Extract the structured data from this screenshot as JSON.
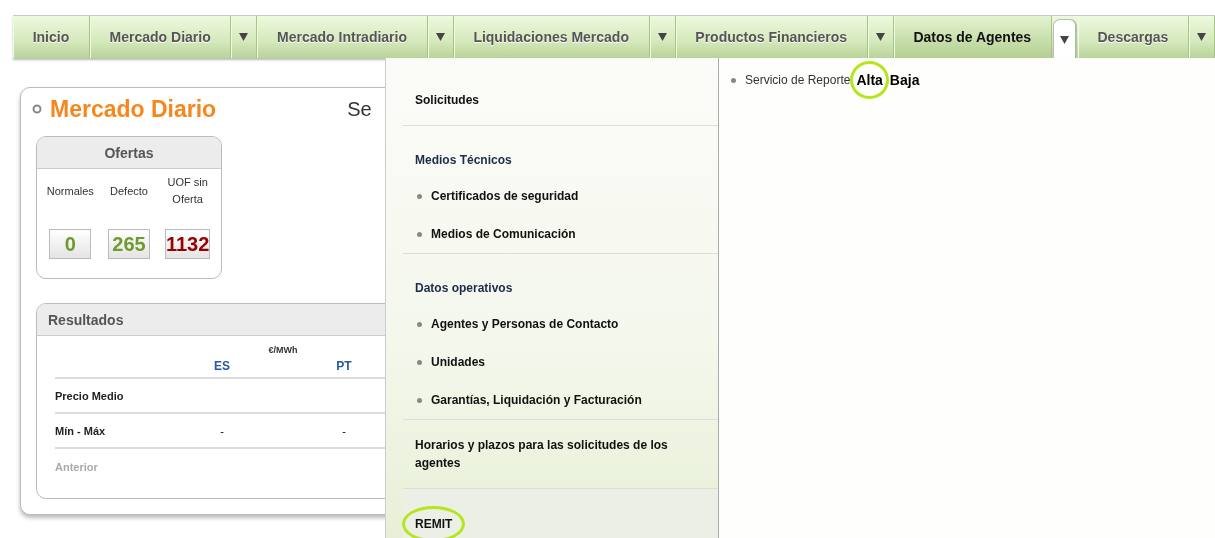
{
  "nav": {
    "items": [
      {
        "label": "Inicio",
        "has_menu": false,
        "selected": false
      },
      {
        "label": "Mercado Diario",
        "has_menu": true,
        "selected": false
      },
      {
        "label": "Mercado Intradiario",
        "has_menu": true,
        "selected": false
      },
      {
        "label": "Liquidaciones Mercado",
        "has_menu": true,
        "selected": false
      },
      {
        "label": "Productos Financieros",
        "has_menu": true,
        "selected": false
      },
      {
        "label": "Datos de Agentes",
        "has_menu": true,
        "selected": true
      },
      {
        "label": "Descargas",
        "has_menu": true,
        "selected": false
      }
    ]
  },
  "card": {
    "title": "Mercado Diario",
    "title_right": "Se",
    "offers": {
      "title": "Ofertas",
      "columns": [
        {
          "label": "Normales",
          "value": "0",
          "color": "#6f9a2e"
        },
        {
          "label": "Defecto",
          "value": "265",
          "color": "#6f9a2e"
        },
        {
          "label": "UOF sin Oferta",
          "value": "1132",
          "color": "#990000"
        }
      ]
    },
    "results": {
      "title": "Resultados",
      "unit": "€/MWh",
      "columns": [
        "ES",
        "PT"
      ],
      "rows": [
        {
          "label": "Precio Medio"
        },
        {
          "label": "Mín - Máx",
          "values": [
            "-",
            "-"
          ]
        }
      ],
      "previous_link": "Anterior"
    }
  },
  "menu": {
    "sections": [
      {
        "kind": "link",
        "title": "Solicitudes",
        "selected": false,
        "highlighted": false
      },
      {
        "kind": "heading",
        "title": "Medios Técnicos",
        "items": [
          {
            "label": "Certificados de seguridad"
          },
          {
            "label": "Medios de Comunicación"
          }
        ]
      },
      {
        "kind": "heading",
        "title": "Datos operativos",
        "items": [
          {
            "label": "Agentes y Personas de Contacto"
          },
          {
            "label": "Unidades"
          },
          {
            "label": "Garantías, Liquidación y Facturación"
          }
        ]
      },
      {
        "kind": "link",
        "title": "Horarios y plazos para las solicitudes de los agentes",
        "selected": false,
        "highlighted": false
      },
      {
        "kind": "link",
        "title": "REMIT",
        "selected": true,
        "highlighted": true
      }
    ],
    "detail": {
      "items": [
        {
          "label": "Servicio de Reporte",
          "links": [
            {
              "label": "Alta",
              "highlighted": true
            },
            {
              "label": "Baja",
              "highlighted": false
            }
          ]
        }
      ]
    }
  }
}
